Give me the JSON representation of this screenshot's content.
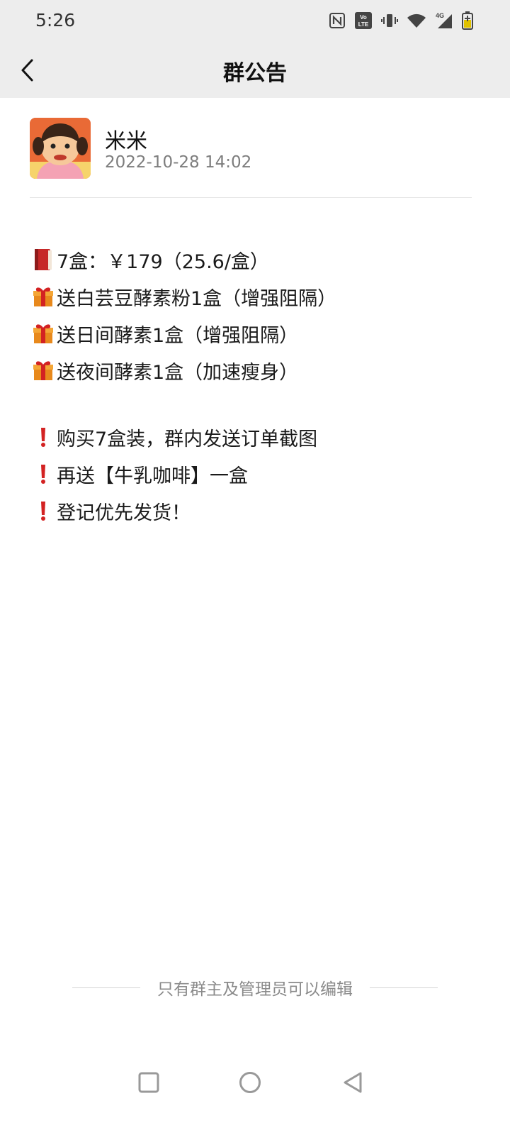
{
  "status_bar": {
    "time": "5:26",
    "icons": [
      "nfc-icon",
      "volte-icon",
      "vibrate-icon",
      "wifi-icon",
      "signal-4g-icon",
      "battery-charging-icon"
    ],
    "network_label": "4G",
    "volte_label_top": "Vo",
    "volte_label_bottom": "LTE"
  },
  "nav": {
    "title": "群公告",
    "back_icon": "chevron-left-icon"
  },
  "post": {
    "author": "米米",
    "timestamp": "2022-10-28 14:02"
  },
  "announcement": {
    "offer_lines": [
      {
        "icon": "red-book-emoji",
        "text": "7盒：￥179（25.6/盒）"
      },
      {
        "icon": "gift-emoji",
        "text": "送白芸豆酵素粉1盒（增强阻隔）"
      },
      {
        "icon": "gift-emoji",
        "text": "送日间酵素1盒（增强阻隔）"
      },
      {
        "icon": "gift-emoji",
        "text": "送夜间酵素1盒（加速瘦身）"
      }
    ],
    "notice_lines": [
      {
        "icon": "red-exclamation-emoji",
        "text": "购买7盒装，群内发送订单截图"
      },
      {
        "icon": "red-exclamation-emoji",
        "text": "再送【牛乳咖啡】一盒"
      },
      {
        "icon": "red-exclamation-emoji",
        "text": "登记优先发货！"
      }
    ]
  },
  "footer": {
    "note": "只有群主及管理员可以编辑"
  },
  "system_nav": {
    "buttons": [
      "recents-square-icon",
      "home-circle-icon",
      "back-triangle-icon"
    ]
  },
  "colors": {
    "header_bg": "#ededed",
    "page_bg": "#ffffff",
    "meta_text": "#7d7d7d",
    "accent_red": "#d32222"
  }
}
